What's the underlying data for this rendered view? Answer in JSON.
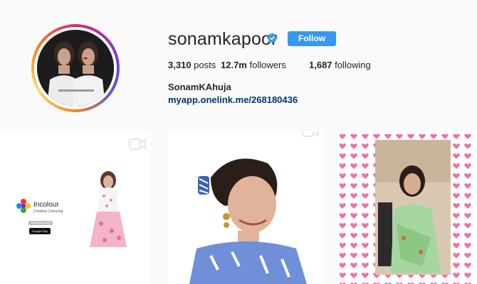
{
  "profile": {
    "username": "sonamkapoor",
    "verified_icon": "verified-badge-icon",
    "follow_label": "Follow",
    "stats": {
      "posts_value": "3,310",
      "posts_label": "posts",
      "followers_value": "12.7m",
      "followers_label": "followers",
      "following_value": "1,687",
      "following_label": "following"
    },
    "full_name": "SonamKAhuja",
    "link": "myapp.onelink.me/268180436"
  },
  "posts": [
    {
      "type": "video",
      "icon": "video-camera-icon",
      "brand_name": "Incolour",
      "brand_sub": "Creative Colouring",
      "download_label": "Download now",
      "store_label": "Google Play"
    },
    {
      "type": "video",
      "icon": "video-camera-icon"
    },
    {
      "type": "photo"
    }
  ],
  "colors": {
    "follow_button": "#3897f0",
    "link": "#003569",
    "background": "#fafafa",
    "verified": "#3897f0"
  }
}
